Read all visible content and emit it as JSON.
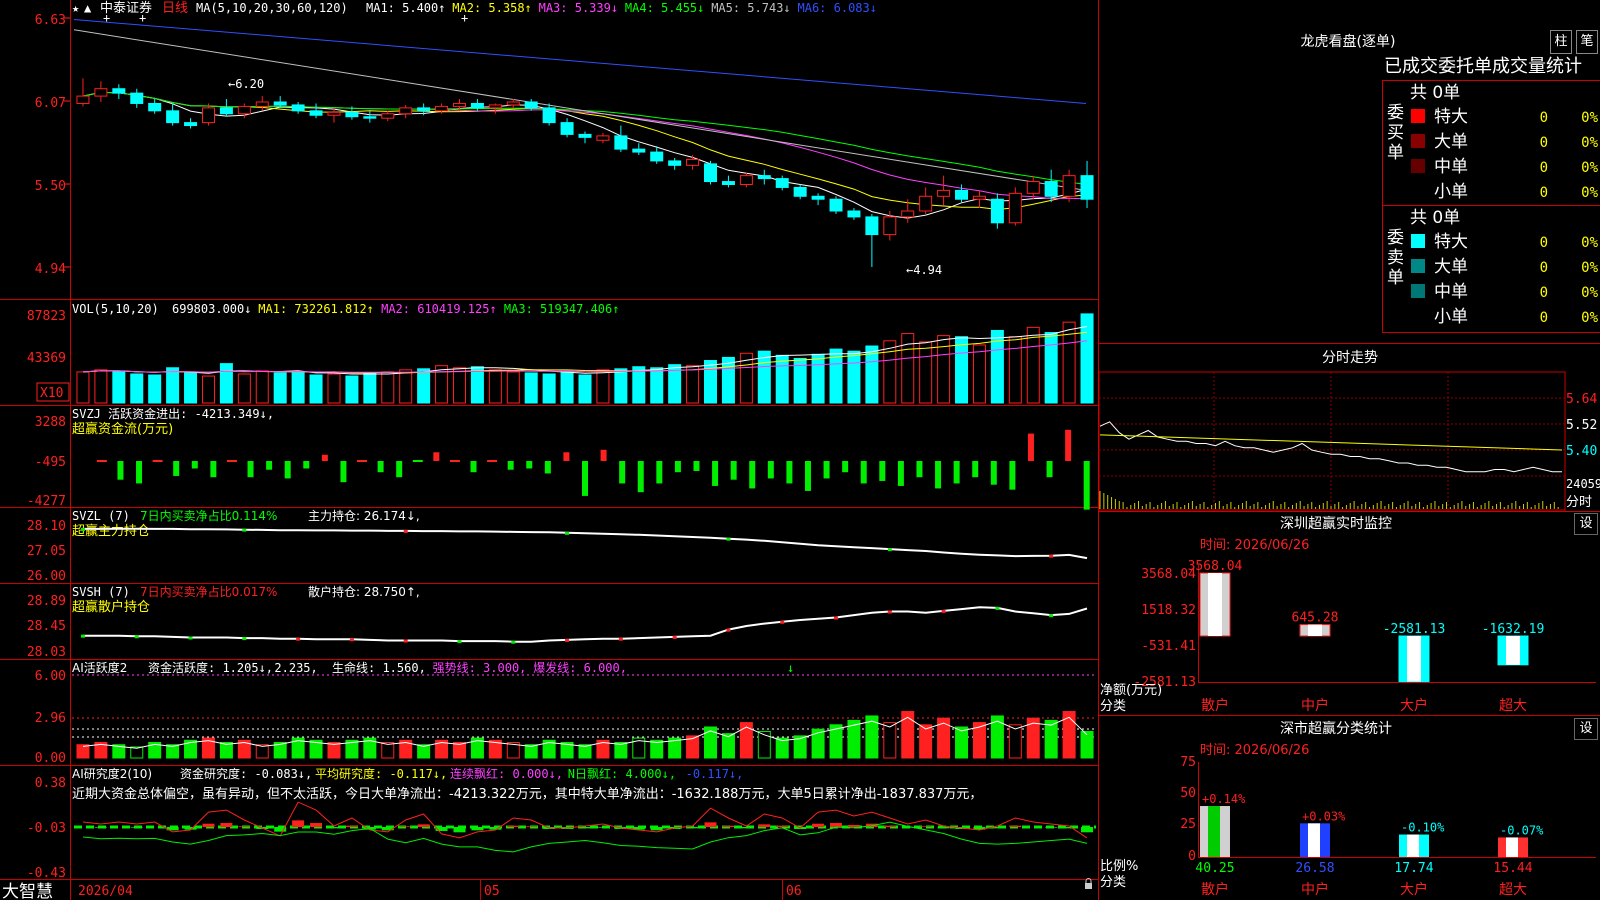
{
  "app": {
    "brand": "大智慧"
  },
  "main_chart": {
    "stock_name": "中泰证券",
    "period": "日线",
    "ma_label": "MA(5,10,20,30,60,120)",
    "ma_items": [
      {
        "text": "MA1: 5.400↑",
        "color": "#ffffff"
      },
      {
        "text": "MA2: 5.358↑",
        "color": "#ffff00"
      },
      {
        "text": "MA3: 5.339↓",
        "color": "#ff40ff"
      },
      {
        "text": "MA4: 5.455↓",
        "color": "#00ff00"
      },
      {
        "text": "MA5: 5.743↓",
        "color": "#c0c0c0"
      },
      {
        "text": "MA6: 6.083↓",
        "color": "#3050ff"
      }
    ],
    "y_ticks": [
      "6.63",
      "6.07",
      "5.50",
      "4.94"
    ],
    "high_marker": "←6.20",
    "low_marker": "←4.94",
    "dates": [
      "2026/04",
      "05",
      "06"
    ]
  },
  "volume_pane": {
    "header": "VOL(5,10,20)",
    "items": [
      {
        "text": "699803.000↓",
        "color": "#ffffff"
      },
      {
        "text": "MA1: 732261.812↑",
        "color": "#ffff00"
      },
      {
        "text": "MA2: 610419.125↑",
        "color": "#ff40ff"
      },
      {
        "text": "MA3: 519347.406↑",
        "color": "#00ff00"
      }
    ],
    "y_ticks": [
      "87823",
      "43369"
    ],
    "unit": "X10"
  },
  "svzj_pane": {
    "header": "SVZJ  活跃资金进出: -4213.349↓,",
    "subtitle": "超赢资金流(万元)",
    "y_ticks": [
      "3288",
      "-495",
      "-4277"
    ]
  },
  "svzl_pane": {
    "name": "SVZL (7)",
    "pct_text": "7日内买卖净占比0.114%",
    "hold_text": "主力持仓: 26.174↓,",
    "subtitle": "超赢主力持仓",
    "y_ticks": [
      "28.10",
      "27.05",
      "26.00"
    ]
  },
  "svsh_pane": {
    "name": "SVSH (7)",
    "pct_text": "7日内买卖净占比0.017%",
    "hold_text": "散户持仓: 28.750↑,",
    "subtitle": "超赢散户持仓",
    "y_ticks": [
      "28.89",
      "28.45",
      "28.03"
    ]
  },
  "ai_activity_pane": {
    "name": "AI活跃度2",
    "items": [
      {
        "text": "资金活跃度: 1.205↓,",
        "color": "#ffffff"
      },
      {
        "text": "2.235,",
        "color": "#ffffff"
      },
      {
        "text": "生命线: 1.560,",
        "color": "#ffffff"
      },
      {
        "text": "强势线: 3.000,",
        "color": "#ff40ff"
      },
      {
        "text": "爆发线: 6.000,",
        "color": "#ff40ff"
      }
    ],
    "y_ticks": [
      "6.00",
      "2.96",
      "0.00"
    ]
  },
  "ai_research_pane": {
    "name": "AI研究度2(10)",
    "items": [
      {
        "text": "资金研究度: -0.083↓,",
        "color": "#ffffff"
      },
      {
        "text": "平均研究度: -0.117↓,",
        "color": "#ffff00"
      },
      {
        "text": "连续飘红: 0.000↓,",
        "color": "#ff40ff"
      },
      {
        "text": "N日飘红: 4.000↓,",
        "color": "#00ff00"
      },
      {
        "text": "-0.117↓,",
        "color": "#3050ff"
      }
    ],
    "comment": "近期大资金总体偏空，虽有异动，但不太活跃，今日大单净流出：-4213.322万元，其中特大单净流出：-1632.188万元，大单5日累计净出-1837.837万元，",
    "y_ticks": [
      "0.38",
      "-0.03",
      "-0.43"
    ]
  },
  "dragon_tiger": {
    "title": "龙虎看盘(逐单)",
    "btn_bar": "柱",
    "btn_pen": "笔",
    "section_title": "已成交委托单成交量统计",
    "buy": {
      "label": "委买单",
      "total": "共 0单",
      "rows": [
        {
          "name": "特大",
          "count": "0",
          "pct": "0%",
          "color": "#ff0000"
        },
        {
          "name": "大单",
          "count": "0",
          "pct": "0%",
          "color": "#880000"
        },
        {
          "name": "中单",
          "count": "0",
          "pct": "0%",
          "color": "#660000"
        },
        {
          "name": "小单",
          "count": "0",
          "pct": "0%",
          "color": "#000000"
        }
      ]
    },
    "sell": {
      "label": "委卖单",
      "total": "共 0单",
      "rows": [
        {
          "name": "特大",
          "count": "0",
          "pct": "0%",
          "color": "#00ffff"
        },
        {
          "name": "大单",
          "count": "0",
          "pct": "0%",
          "color": "#008888"
        },
        {
          "name": "中单",
          "count": "0",
          "pct": "0%",
          "color": "#007777"
        },
        {
          "name": "小单",
          "count": "0",
          "pct": "0%",
          "color": "#000000"
        }
      ]
    }
  },
  "intraday": {
    "title": "分时走势",
    "y_ticks": [
      "5.64",
      "5.52",
      "5.40"
    ],
    "volume_tick": "24059",
    "label": "分时"
  },
  "monitor": {
    "title": "深圳超赢实时监控",
    "set_label": "设",
    "time_text": "时间: 2026/06/26",
    "y_ticks": [
      "3568.04",
      "1518.32",
      "-531.41",
      "-2581.13"
    ],
    "axis_label_1": "净额(万元)",
    "axis_label_2": "分类",
    "bars": [
      {
        "cat": "散户",
        "value": "3568.04"
      },
      {
        "cat": "中户",
        "value": "645.28"
      },
      {
        "cat": "大户",
        "value": "-2581.13"
      },
      {
        "cat": "超大",
        "value": "-1632.19"
      }
    ]
  },
  "classify": {
    "title": "深市超赢分类统计",
    "set_label": "设",
    "time_text": "时间: 2026/06/26",
    "y_ticks": [
      "75",
      "50",
      "25",
      "0"
    ],
    "axis_label_1": "比例%",
    "axis_label_2": "分类",
    "bars": [
      {
        "cat": "散户",
        "pct": "+0.14%",
        "ratio": "40.25"
      },
      {
        "cat": "中户",
        "pct": "+0.03%",
        "ratio": "26.58"
      },
      {
        "cat": "大户",
        "pct": "-0.10%",
        "ratio": "17.74"
      },
      {
        "cat": "超大",
        "pct": "-0.07%",
        "ratio": "15.44"
      }
    ]
  },
  "chart_data": [
    {
      "type": "candlestick",
      "title": "中泰证券 日线",
      "ylim": [
        4.94,
        6.63
      ],
      "ohlc": [
        [
          6.05,
          6.22,
          6.03,
          6.1
        ],
        [
          6.1,
          6.2,
          6.06,
          6.15
        ],
        [
          6.15,
          6.18,
          6.08,
          6.12
        ],
        [
          6.12,
          6.15,
          6.02,
          6.05
        ],
        [
          6.05,
          6.08,
          5.98,
          6.0
        ],
        [
          6.0,
          6.05,
          5.9,
          5.92
        ],
        [
          5.92,
          5.95,
          5.88,
          5.9
        ],
        [
          5.92,
          6.05,
          5.9,
          6.02
        ],
        [
          6.02,
          6.08,
          5.96,
          5.98
        ],
        [
          5.98,
          6.05,
          5.95,
          6.03
        ],
        [
          6.03,
          6.1,
          6.0,
          6.06
        ],
        [
          6.06,
          6.1,
          6.02,
          6.04
        ],
        [
          6.04,
          6.06,
          5.98,
          6.0
        ],
        [
          6.0,
          6.05,
          5.95,
          5.97
        ],
        [
          5.97,
          6.02,
          5.92,
          5.99
        ],
        [
          5.99,
          6.03,
          5.94,
          5.96
        ],
        [
          5.96,
          6.0,
          5.92,
          5.95
        ],
        [
          5.95,
          6.0,
          5.93,
          5.98
        ],
        [
          5.98,
          6.04,
          5.95,
          6.02
        ],
        [
          6.02,
          6.05,
          5.97,
          6.0
        ],
        [
          6.0,
          6.05,
          5.98,
          6.03
        ],
        [
          6.03,
          6.08,
          6.0,
          6.05
        ],
        [
          6.05,
          6.08,
          6.0,
          6.02
        ],
        [
          6.02,
          6.05,
          5.98,
          6.04
        ],
        [
          6.04,
          6.08,
          6.02,
          6.06
        ],
        [
          6.06,
          6.08,
          6.0,
          6.02
        ],
        [
          6.02,
          6.05,
          5.9,
          5.92
        ],
        [
          5.92,
          5.95,
          5.82,
          5.84
        ],
        [
          5.84,
          5.86,
          5.78,
          5.82
        ],
        [
          5.8,
          5.85,
          5.78,
          5.83
        ],
        [
          5.83,
          5.9,
          5.72,
          5.74
        ],
        [
          5.74,
          5.78,
          5.7,
          5.72
        ],
        [
          5.72,
          5.76,
          5.64,
          5.66
        ],
        [
          5.66,
          5.68,
          5.6,
          5.63
        ],
        [
          5.63,
          5.7,
          5.6,
          5.67
        ],
        [
          5.64,
          5.66,
          5.5,
          5.52
        ],
        [
          5.52,
          5.56,
          5.48,
          5.5
        ],
        [
          5.5,
          5.58,
          5.48,
          5.56
        ],
        [
          5.56,
          5.6,
          5.5,
          5.54
        ],
        [
          5.54,
          5.56,
          5.46,
          5.48
        ],
        [
          5.48,
          5.5,
          5.4,
          5.42
        ],
        [
          5.42,
          5.44,
          5.36,
          5.4
        ],
        [
          5.4,
          5.42,
          5.3,
          5.32
        ],
        [
          5.32,
          5.34,
          5.26,
          5.28
        ],
        [
          5.28,
          5.3,
          4.94,
          5.16
        ],
        [
          5.16,
          5.32,
          5.12,
          5.28
        ],
        [
          5.28,
          5.4,
          5.24,
          5.32
        ],
        [
          5.32,
          5.48,
          5.3,
          5.42
        ],
        [
          5.42,
          5.56,
          5.36,
          5.46
        ],
        [
          5.46,
          5.5,
          5.38,
          5.4
        ],
        [
          5.4,
          5.46,
          5.34,
          5.42
        ],
        [
          5.4,
          5.44,
          5.2,
          5.24
        ],
        [
          5.24,
          5.48,
          5.22,
          5.44
        ],
        [
          5.44,
          5.56,
          5.4,
          5.52
        ],
        [
          5.52,
          5.6,
          5.38,
          5.42
        ],
        [
          5.42,
          5.6,
          5.38,
          5.56
        ],
        [
          5.56,
          5.66,
          5.34,
          5.4
        ]
      ]
    },
    {
      "type": "bar",
      "title": "VOL(5,10,20)",
      "ylim": [
        0,
        87823
      ],
      "values": [
        3.0,
        3.2,
        3.1,
        2.8,
        2.7,
        3.4,
        2.9,
        2.6,
        3.8,
        2.8,
        3.1,
        2.9,
        3.0,
        2.7,
        2.8,
        2.6,
        2.9,
        3.0,
        3.2,
        3.3,
        3.6,
        3.4,
        3.5,
        3.2,
        3.0,
        2.9,
        2.8,
        3.0,
        2.7,
        3.2,
        3.3,
        3.5,
        3.4,
        3.7,
        3.6,
        4.1,
        4.4,
        4.8,
        5.0,
        4.6,
        4.3,
        4.7,
        5.2,
        5.0,
        5.5,
        6.0,
        6.7,
        5.9,
        6.5,
        6.4,
        5.6,
        7.0,
        6.4,
        7.3,
        6.8,
        7.8,
        8.6
      ]
    },
    {
      "type": "bar",
      "title": "超赢资金流(万元)",
      "ylim": [
        -4277,
        3288
      ],
      "values": [
        0,
        150,
        -1500,
        -1800,
        300,
        -1200,
        -600,
        -1300,
        350,
        -1300,
        -700,
        -1400,
        -600,
        500,
        -1700,
        400,
        -900,
        -1300,
        -400,
        700,
        400,
        -900,
        350,
        -700,
        -600,
        -1000,
        700,
        -2800,
        900,
        -1800,
        -2500,
        -1800,
        -900,
        -800,
        -2000,
        -1500,
        -2200,
        -1400,
        -1800,
        -2400,
        -1400,
        -900,
        -1800,
        -1600,
        -2000,
        -1300,
        -2200,
        -1800,
        -1300,
        -1900,
        -2300,
        2200,
        -1300,
        2500,
        -3900
      ]
    },
    {
      "type": "line",
      "title": "超赢主力持仓",
      "ylim": [
        26.0,
        28.1
      ],
      "values": [
        28.02,
        28.02,
        28.03,
        28.03,
        28.02,
        28.02,
        28.01,
        28.01,
        28.0,
        27.99,
        27.98,
        27.97,
        27.97,
        27.96,
        27.96,
        27.95,
        27.95,
        27.94,
        27.94,
        27.93,
        27.93,
        27.92,
        27.92,
        27.91,
        27.9,
        27.89,
        27.88,
        27.86,
        27.84,
        27.82,
        27.8,
        27.78,
        27.75,
        27.72,
        27.69,
        27.66,
        27.62,
        27.58,
        27.53,
        27.47,
        27.41,
        27.35,
        27.31,
        27.27,
        27.23,
        27.19,
        27.15,
        27.11,
        27.05,
        27.0,
        26.96,
        26.93,
        26.9,
        26.91,
        26.92,
        26.95,
        26.82
      ]
    },
    {
      "type": "line",
      "title": "超赢散户持仓",
      "ylim": [
        28.03,
        28.89
      ],
      "values": [
        28.3,
        28.3,
        28.3,
        28.29,
        28.29,
        28.28,
        28.27,
        28.27,
        28.27,
        28.26,
        28.26,
        28.25,
        28.25,
        28.24,
        28.24,
        28.24,
        28.23,
        28.22,
        28.22,
        28.22,
        28.22,
        28.21,
        28.21,
        28.21,
        28.2,
        28.2,
        28.22,
        28.23,
        28.24,
        28.25,
        28.25,
        28.26,
        28.27,
        28.28,
        28.29,
        28.3,
        28.4,
        28.46,
        28.5,
        28.53,
        28.56,
        28.58,
        28.6,
        28.64,
        28.68,
        28.7,
        28.7,
        28.68,
        28.71,
        28.74,
        28.77,
        28.76,
        28.7,
        28.67,
        28.64,
        28.66,
        28.75
      ]
    },
    {
      "type": "bar",
      "title": "AI活跃度2",
      "ylim": [
        0,
        6.0
      ],
      "values": [
        0.6,
        0.7,
        0.6,
        0.5,
        0.7,
        0.6,
        0.8,
        0.9,
        0.7,
        0.8,
        0.6,
        0.7,
        0.9,
        0.8,
        0.7,
        0.8,
        0.9,
        0.7,
        0.8,
        0.6,
        0.8,
        0.7,
        0.9,
        0.8,
        0.7,
        0.6,
        0.8,
        0.7,
        0.6,
        0.8,
        0.7,
        0.9,
        0.8,
        0.9,
        1.0,
        1.4,
        1.1,
        1.6,
        1.2,
        0.9,
        1.0,
        1.3,
        1.5,
        1.7,
        1.9,
        1.6,
        2.1,
        1.5,
        1.8,
        1.4,
        1.6,
        1.9,
        1.5,
        1.8,
        1.7,
        2.1,
        1.2
      ]
    },
    {
      "type": "bar",
      "title": "AI研究度2(10)",
      "ylim": [
        -0.43,
        0.38
      ],
      "values": [
        0.0,
        -0.01,
        0.0,
        -0.01,
        0.0,
        -0.05,
        -0.04,
        0.05,
        0.06,
        0.01,
        -0.03,
        -0.07,
        0.1,
        0.06,
        -0.02,
        0.02,
        -0.04,
        -0.05,
        0.01,
        0.04,
        -0.06,
        -0.08,
        -0.05,
        -0.04,
        0.02,
        0.01,
        -0.03,
        -0.03,
        -0.02,
        -0.01,
        -0.03,
        -0.04,
        -0.05,
        -0.03,
        -0.02,
        0.07,
        0.02,
        -0.02,
        0.04,
        0.02,
        -0.03,
        0.05,
        0.06,
        0.03,
        0.05,
        0.02,
        -0.01,
        0.01,
        -0.02,
        -0.03,
        -0.04,
        -0.02,
        0.02,
        0.0,
        -0.01,
        -0.02,
        -0.08
      ]
    },
    {
      "type": "line",
      "title": "分时走势",
      "ylim": [
        5.28,
        5.64
      ],
      "values": [
        5.51,
        5.53,
        5.48,
        5.45,
        5.47,
        5.49,
        5.46,
        5.45,
        5.44,
        5.44,
        5.43,
        5.43,
        5.42,
        5.44,
        5.42,
        5.41,
        5.41,
        5.4,
        5.39,
        5.4,
        5.41,
        5.43,
        5.4,
        5.39,
        5.38,
        5.38,
        5.37,
        5.37,
        5.36,
        5.36,
        5.35,
        5.34,
        5.34,
        5.33,
        5.33,
        5.32,
        5.32,
        5.31,
        5.3,
        5.3,
        5.3,
        5.31,
        5.31,
        5.3,
        5.31,
        5.32,
        5.31,
        5.3,
        5.3
      ]
    },
    {
      "type": "bar",
      "title": "深圳超赢实时监控",
      "categories": [
        "散户",
        "中户",
        "大户",
        "超大"
      ],
      "values": [
        3568.04,
        645.28,
        -2581.13,
        -1632.19
      ],
      "ylim": [
        -2581.13,
        3568.04
      ]
    },
    {
      "type": "bar",
      "title": "深市超赢分类统计",
      "categories": [
        "散户",
        "中户",
        "大户",
        "超大"
      ],
      "values": [
        40.25,
        26.58,
        17.74,
        15.44
      ],
      "ylim": [
        0,
        75
      ]
    }
  ]
}
